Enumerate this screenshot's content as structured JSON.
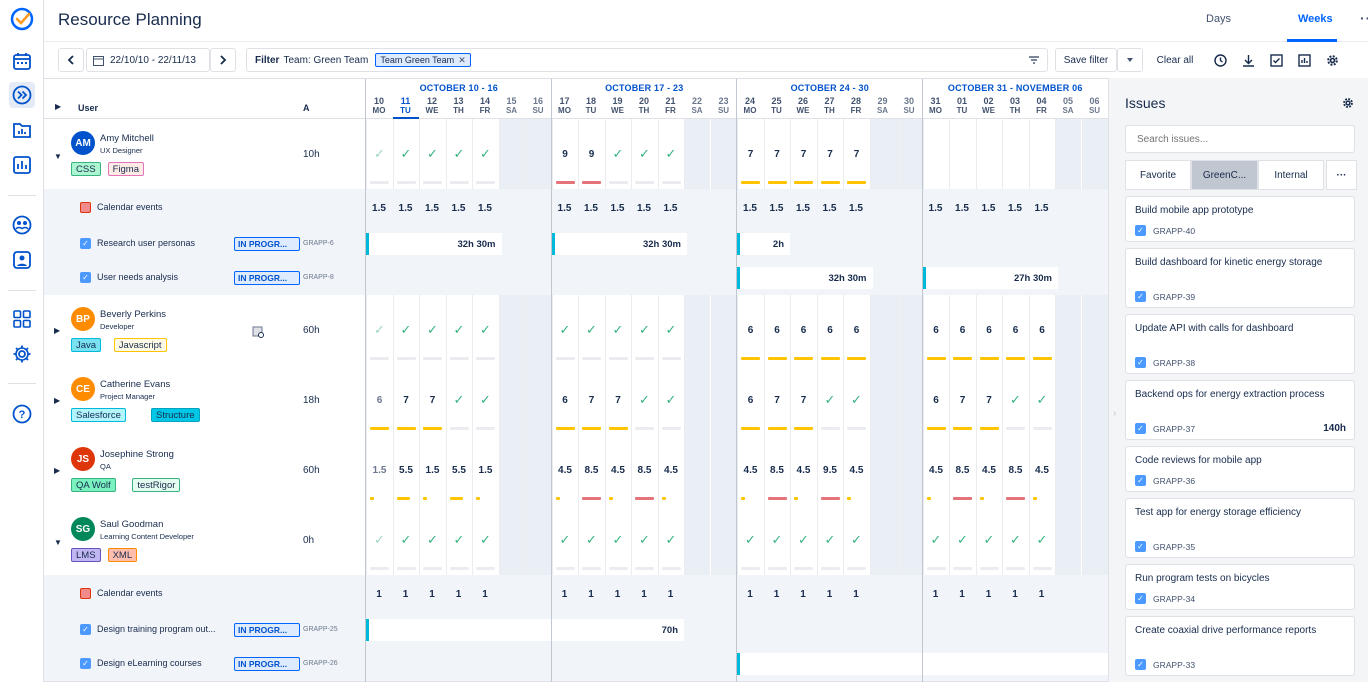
{
  "header": {
    "title": "Resource Planning",
    "tab_days": "Days",
    "tab_weeks": "Weeks",
    "more": "···"
  },
  "toolbar": {
    "date_range": "22/10/10 - 22/11/13",
    "filter_label": "Filter",
    "filter_team": "Team: Green Team",
    "chip": "Team Green Team",
    "save_filter": "Save filter",
    "clear_all": "Clear all"
  },
  "columns": {
    "user": "User",
    "a": "A"
  },
  "weeks": [
    {
      "label": "OCTOBER 10 - 16",
      "days": [
        [
          "10",
          "MO"
        ],
        [
          "11",
          "TU"
        ],
        [
          "12",
          "WE"
        ],
        [
          "13",
          "TH"
        ],
        [
          "14",
          "FR"
        ],
        [
          "15",
          "SA"
        ],
        [
          "16",
          "SU"
        ]
      ]
    },
    {
      "label": "OCTOBER 17 - 23",
      "days": [
        [
          "17",
          "MO"
        ],
        [
          "18",
          "TU"
        ],
        [
          "19",
          "WE"
        ],
        [
          "20",
          "TH"
        ],
        [
          "21",
          "FR"
        ],
        [
          "22",
          "SA"
        ],
        [
          "23",
          "SU"
        ]
      ]
    },
    {
      "label": "OCTOBER 24 - 30",
      "days": [
        [
          "24",
          "MO"
        ],
        [
          "25",
          "TU"
        ],
        [
          "26",
          "WE"
        ],
        [
          "27",
          "TH"
        ],
        [
          "28",
          "FR"
        ],
        [
          "29",
          "SA"
        ],
        [
          "30",
          "SU"
        ]
      ]
    },
    {
      "label": "OCTOBER 31 - NOVEMBER 06",
      "days": [
        [
          "31",
          "MO"
        ],
        [
          "01",
          "TU"
        ],
        [
          "02",
          "WE"
        ],
        [
          "03",
          "TH"
        ],
        [
          "04",
          "FR"
        ],
        [
          "05",
          "SA"
        ],
        [
          "06",
          "SU"
        ]
      ]
    }
  ],
  "users": [
    {
      "initials": "AM",
      "name": "Amy Mitchell",
      "role": "UX Designer",
      "total": "10h",
      "color": "#0052cc",
      "expanded": true,
      "tags": [
        {
          "t": "CSS",
          "bg": "#abf5d1",
          "bd": "#36b37e"
        },
        {
          "t": "Figma",
          "bg": "#ffebe6",
          "bd": "#e774bb"
        }
      ],
      "cells": [
        "c",
        "c",
        "c",
        "c",
        "c",
        "9",
        "9",
        "c",
        "c",
        "c",
        "7",
        "7",
        "7",
        "7",
        "7"
      ],
      "bars": [
        "",
        "",
        "",
        "",
        "",
        "r",
        "r",
        "",
        "",
        "",
        "y",
        "y",
        "y",
        "y",
        "y"
      ]
    },
    {
      "initials": "BP",
      "name": "Beverly Perkins",
      "role": "Developer",
      "total": "60h",
      "color": "#ff8b00",
      "expanded": false,
      "tags": [
        {
          "t": "Java",
          "bg": "#79e2f2",
          "bd": "#00b8d9"
        },
        {
          "t": "Javascript",
          "bg": "#fffae6",
          "bd": "#ffc400"
        }
      ],
      "cells": [
        "c",
        "c",
        "c",
        "c",
        "c",
        "c",
        "c",
        "c",
        "c",
        "c",
        "6",
        "6",
        "6",
        "6",
        "6",
        "6",
        "6",
        "6",
        "6",
        "6"
      ],
      "bars": [
        "",
        "",
        "",
        "",
        "",
        "",
        "",
        "",
        "",
        "",
        "y",
        "y",
        "y",
        "y",
        "y",
        "y",
        "y",
        "y",
        "y",
        "y"
      ]
    },
    {
      "initials": "CE",
      "name": "Catherine Evans",
      "role": "Project Manager",
      "total": "18h",
      "color": "#ff8b00",
      "expanded": false,
      "tags": [
        {
          "t": "Salesforce",
          "bg": "#b3f5ff",
          "bd": "#00b8d9"
        },
        {
          "t": "Structure",
          "bg": "#00c7e6",
          "bd": "#00a3bf"
        }
      ],
      "cells": [
        "6",
        "7",
        "7",
        "c",
        "c",
        "6",
        "7",
        "7",
        "c",
        "c",
        "6",
        "7",
        "7",
        "c",
        "c",
        "6",
        "7",
        "7",
        "c",
        "c"
      ],
      "bars": [
        "y",
        "y",
        "y",
        "",
        "",
        "y",
        "y",
        "y",
        "",
        "",
        "y",
        "y",
        "y",
        "",
        "",
        "y",
        "y",
        "y",
        "",
        ""
      ]
    },
    {
      "initials": "JS",
      "name": "Josephine Strong",
      "role": "QA",
      "total": "60h",
      "color": "#de350b",
      "expanded": false,
      "tags": [
        {
          "t": "QA Wolf",
          "bg": "#79f2c0",
          "bd": "#36b37e"
        },
        {
          "t": "testRigor",
          "bg": "#e3fcef",
          "bd": "#36b37e"
        }
      ],
      "cells": [
        "1.5",
        "5.5",
        "1.5",
        "5.5",
        "1.5",
        "4.5",
        "8.5",
        "4.5",
        "8.5",
        "4.5",
        "4.5",
        "8.5",
        "4.5",
        "9.5",
        "4.5",
        "4.5",
        "8.5",
        "4.5",
        "8.5",
        "4.5"
      ],
      "bars": [
        "y",
        "y",
        "y",
        "y",
        "y",
        "y",
        "r",
        "y",
        "r",
        "y",
        "y",
        "r",
        "y",
        "r",
        "y",
        "y",
        "r",
        "y",
        "r",
        "y"
      ]
    },
    {
      "initials": "SG",
      "name": "Saul Goodman",
      "role": "Learning Content Developer",
      "total": "0h",
      "color": "#00875a",
      "expanded": true,
      "tags": [
        {
          "t": "LMS",
          "bg": "#c0b6f2",
          "bd": "#6554c0"
        },
        {
          "t": "XML",
          "bg": "#ffbdad",
          "bd": "#ff8b00"
        }
      ],
      "cells": [
        "c",
        "c",
        "c",
        "c",
        "c",
        "c",
        "c",
        "c",
        "c",
        "c",
        "c",
        "c",
        "c",
        "c",
        "c",
        "c",
        "c",
        "c",
        "c",
        "c"
      ],
      "bars": [
        "",
        "",
        "",
        "",
        "",
        "",
        "",
        "",
        "",
        "",
        "",
        "",
        "",
        "",
        "",
        "",
        "",
        "",
        "",
        ""
      ]
    }
  ],
  "amy_subrows": [
    {
      "type": "cal",
      "label": "Calendar events",
      "vals": [
        "1.5",
        "1.5",
        "1.5",
        "1.5",
        "1.5",
        "1.5",
        "1.5",
        "1.5",
        "1.5",
        "1.5",
        "1.5",
        "1.5",
        "1.5",
        "1.5",
        "1.5",
        "1.5",
        "1.5",
        "1.5",
        "1.5",
        "1.5"
      ]
    },
    {
      "type": "task",
      "label": "Research user personas",
      "status": "IN PROGR...",
      "key": "GRAPP-6",
      "spans": [
        {
          "w": 0,
          "txt": "32h 30m"
        },
        {
          "w": 1,
          "txt": "32h 30m"
        },
        {
          "w": 2,
          "txt": "2h"
        }
      ]
    },
    {
      "type": "task",
      "label": "User needs analysis",
      "status": "IN PROGR...",
      "key": "GRAPP-8",
      "spans": [
        {
          "w": 2,
          "txt": "32h 30m"
        },
        {
          "w": 3,
          "txt": "27h 30m"
        }
      ]
    }
  ],
  "saul_subrows": [
    {
      "type": "cal",
      "label": "Calendar events",
      "vals": [
        "1",
        "1",
        "1",
        "1",
        "1",
        "1",
        "1",
        "1",
        "1",
        "1",
        "1",
        "1",
        "1",
        "1",
        "1",
        "1",
        "1",
        "1",
        "1",
        "1"
      ]
    },
    {
      "type": "task",
      "label": "Design training program out...",
      "status": "IN PROGR...",
      "key": "GRAPP-25",
      "spans": [
        {
          "w": 0,
          "txt": "70h"
        }
      ]
    },
    {
      "type": "task",
      "label": "Design eLearning courses",
      "status": "IN PROGR...",
      "key": "GRAPP-26",
      "spans": [
        {
          "w": 2,
          "txt": ""
        }
      ]
    }
  ],
  "issues": {
    "title": "Issues",
    "search_placeholder": "Search issues...",
    "tabs": [
      "Favorite",
      "GreenC...",
      "Internal",
      "···"
    ],
    "cards": [
      {
        "title": "Build mobile app prototype",
        "key": "GRAPP-40",
        "hours": ""
      },
      {
        "title": "Build dashboard for kinetic energy storage",
        "key": "GRAPP-39",
        "hours": ""
      },
      {
        "title": "Update API with calls for dashboard",
        "key": "GRAPP-38",
        "hours": ""
      },
      {
        "title": "Backend ops for energy extraction process",
        "key": "GRAPP-37",
        "hours": "140h"
      },
      {
        "title": "Code reviews for mobile app",
        "key": "GRAPP-36",
        "hours": ""
      },
      {
        "title": "Test app for energy storage efficiency",
        "key": "GRAPP-35",
        "hours": ""
      },
      {
        "title": "Run program tests on bicycles",
        "key": "GRAPP-34",
        "hours": ""
      },
      {
        "title": "Create coaxial drive performance reports",
        "key": "GRAPP-33",
        "hours": ""
      }
    ]
  },
  "colors": {
    "accent": "#0065ff",
    "check": "#36b37e",
    "yellow": "#ffc400",
    "red": "#e5737a",
    "span": "#00b8d9"
  }
}
